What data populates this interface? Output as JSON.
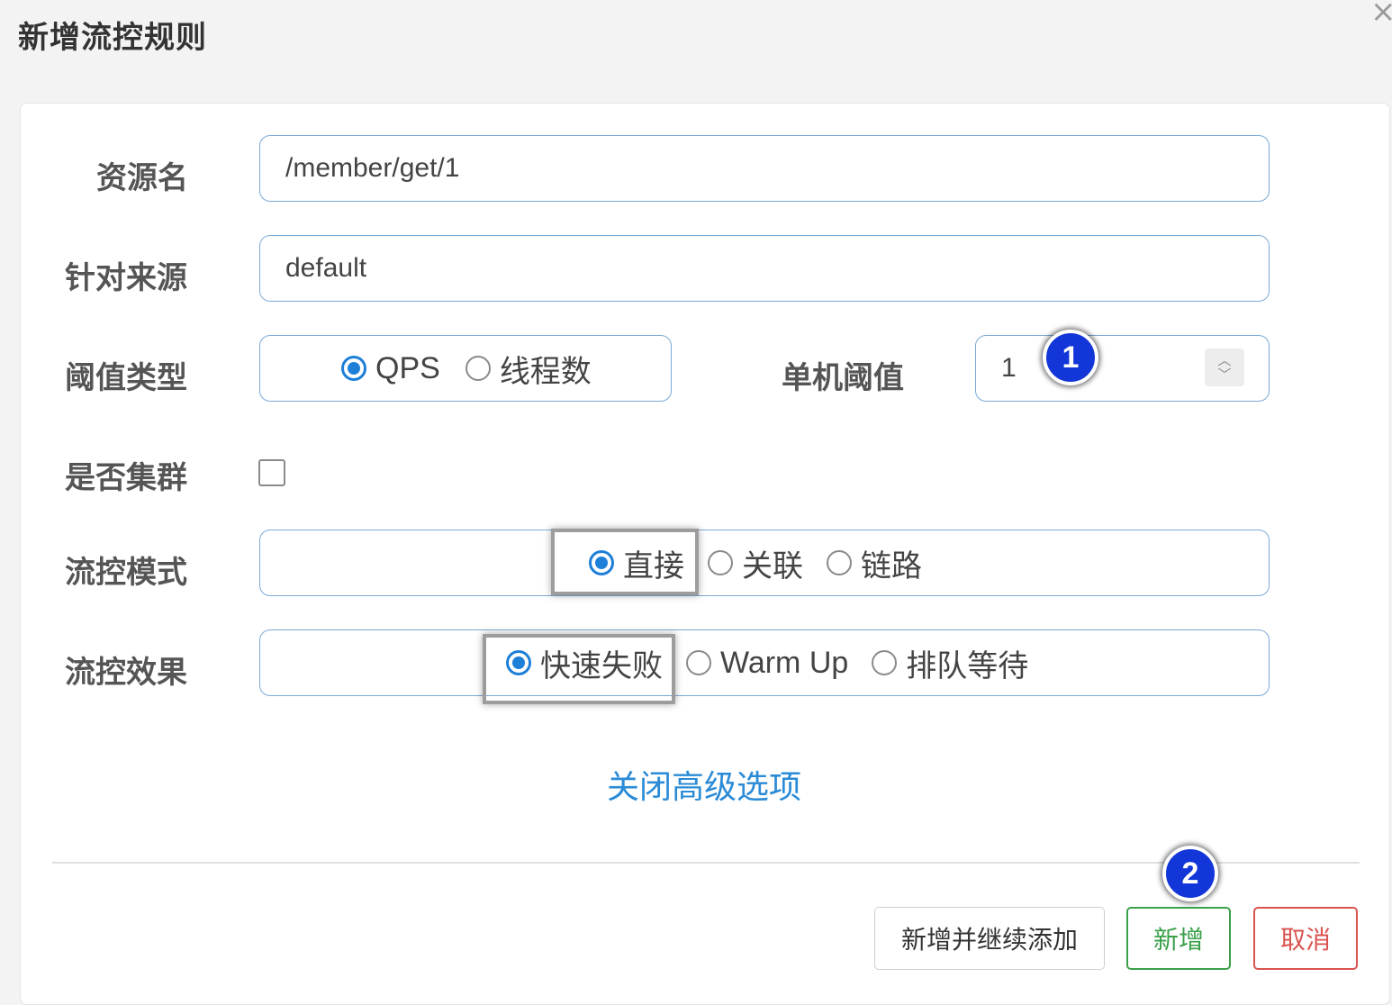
{
  "dialog": {
    "title": "新增流控规则"
  },
  "form": {
    "resource_label": "资源名",
    "resource_value": "/member/get/1",
    "origin_label": "针对来源",
    "origin_value": "default",
    "threshold_type_label": "阈值类型",
    "threshold_type_options": [
      "QPS",
      "线程数"
    ],
    "threshold_type_selected": "QPS",
    "threshold_label": "单机阈值",
    "threshold_value": "1",
    "cluster_label": "是否集群",
    "cluster_checked": false,
    "mode_label": "流控模式",
    "mode_options": [
      "直接",
      "关联",
      "链路"
    ],
    "mode_selected": "直接",
    "effect_label": "流控效果",
    "effect_options": [
      "快速失败",
      "Warm Up",
      "排队等待"
    ],
    "effect_selected": "快速失败",
    "advanced_link": "关闭高级选项"
  },
  "buttons": {
    "add_continue": "新增并继续添加",
    "add": "新增",
    "cancel": "取消"
  },
  "annotations": {
    "marker_1": "1",
    "marker_2": "2"
  },
  "colors": {
    "primary": "#1e7fd8",
    "link": "#2b8bd6",
    "add_button": "#3aa04a",
    "cancel_button": "#d9534f",
    "marker": "#1236d8"
  },
  "icons": {
    "close": "close-icon",
    "spinner": "number-spinner-icon"
  }
}
